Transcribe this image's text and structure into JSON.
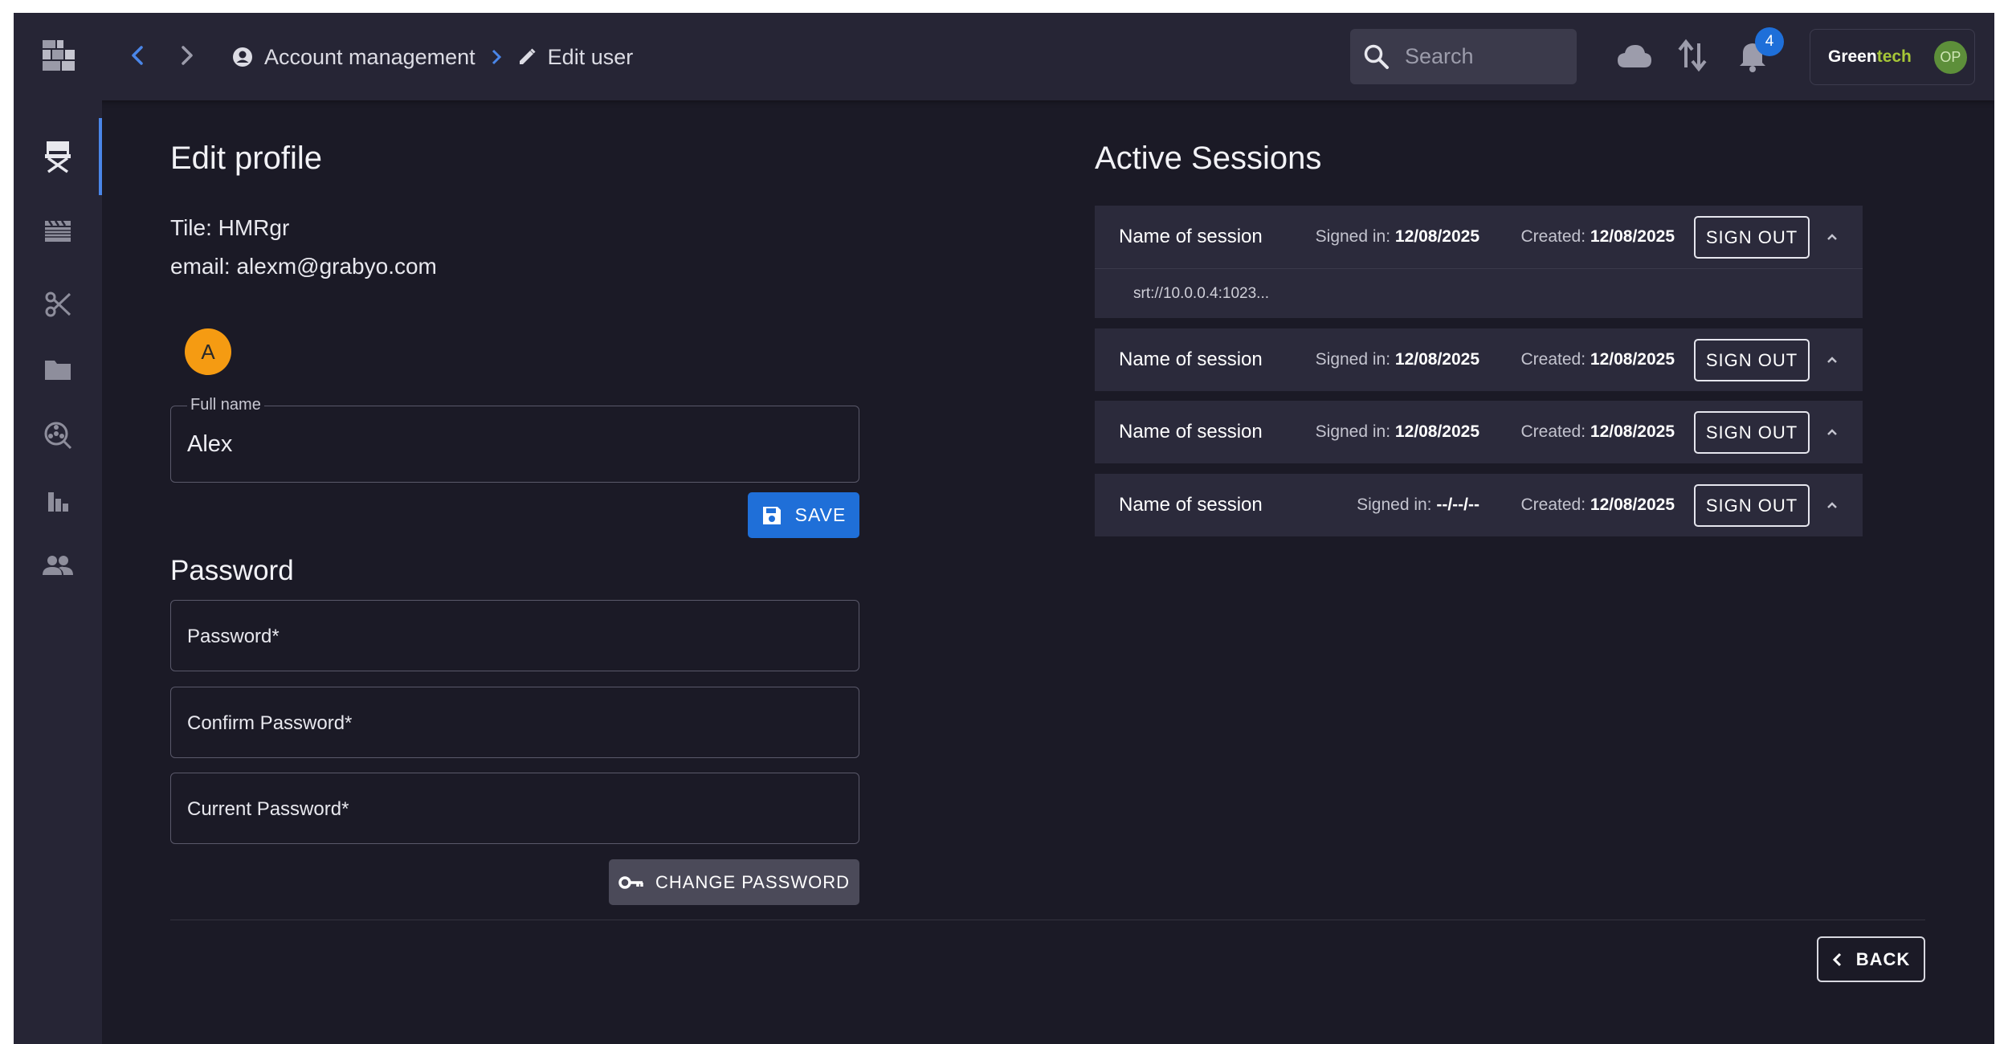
{
  "header": {
    "breadcrumb": {
      "parent": "Account management",
      "current": "Edit user"
    },
    "search": {
      "placeholder": "Search"
    },
    "notifications": {
      "count": "4"
    },
    "account": {
      "brand_part1": "Green",
      "brand_part2": "tech",
      "avatar_initials": "OP"
    },
    "brand_color": "#a6c637",
    "accent_color": "#4a86e8"
  },
  "sidebar": {
    "items": [
      {
        "icon": "director-chair-icon",
        "active": true
      },
      {
        "icon": "clapperboard-icon",
        "active": false
      },
      {
        "icon": "scissors-icon",
        "active": false
      },
      {
        "icon": "folder-icon",
        "active": false
      },
      {
        "icon": "reels-icon",
        "active": false
      },
      {
        "icon": "bar-chart-icon",
        "active": false
      },
      {
        "icon": "people-icon",
        "active": false
      }
    ]
  },
  "profile": {
    "title": "Edit profile",
    "tile_line": "Tile: HMRgr",
    "email_line": "email: alexm@grabyo.com",
    "avatar_letter": "A",
    "full_name_label": "Full name",
    "full_name_value": "Alex",
    "save_label": "SAVE"
  },
  "password": {
    "title": "Password",
    "password_placeholder": "Password*",
    "confirm_placeholder": "Confirm Password*",
    "current_placeholder": "Current Password*",
    "change_label": "CHANGE PASSWORD"
  },
  "sessions": {
    "title": "Active Sessions",
    "signed_label": "Signed in:",
    "created_label": "Created:",
    "signout_label": "SIGN OUT",
    "detail": "srt://10.0.0.4:1023...",
    "items": [
      {
        "name": "Name of session",
        "signed_in": "12/08/2025",
        "created": "12/08/2025"
      },
      {
        "name": "Name of session",
        "signed_in": "12/08/2025",
        "created": "12/08/2025"
      },
      {
        "name": "Name of session",
        "signed_in": "12/08/2025",
        "created": "12/08/2025"
      },
      {
        "name": "Name of session",
        "signed_in": "--/--/--",
        "created": "12/08/2025"
      }
    ]
  },
  "footer": {
    "back_label": "BACK"
  }
}
